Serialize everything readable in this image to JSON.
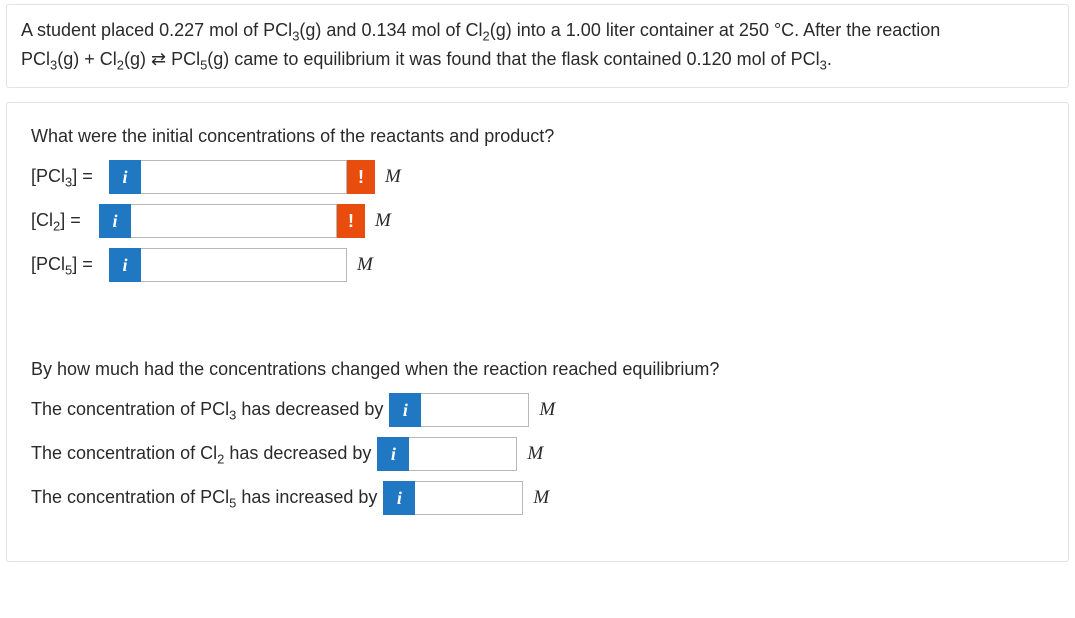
{
  "problem": {
    "line1_pre": "A student placed ",
    "mol_pcl3": "0.227",
    "line1_mid1": " mol of PCl",
    "sub3": "3",
    "line1_mid2": "(g) and ",
    "mol_cl2": "0.134",
    "line1_mid3": " mol of Cl",
    "sub2": "2",
    "line1_mid4": "(g) into a ",
    "volume": "1.00",
    "line1_mid5": " liter container at ",
    "temp": "250",
    "line1_post": " °C. After the reaction",
    "line2_pre": "PCl",
    "line2_a": "(g) + Cl",
    "line2_b": "(g) ",
    "arrows": "⇄",
    "line2_c": " PCl",
    "sub5": "5",
    "line2_d": "(g) came to equilibrium it was found that the flask contained ",
    "eq_mol": "0.120",
    "line2_e": " mol of PCl",
    "line2_end": "."
  },
  "q1": {
    "prompt": "What were the initial concentrations of the reactants and product?",
    "rows": [
      {
        "label_pre": "[PCl",
        "label_sub": "3",
        "label_post": "] = ",
        "error": true,
        "unit": "M",
        "value": ""
      },
      {
        "label_pre": "[Cl",
        "label_sub": "2",
        "label_post": "] = ",
        "error": true,
        "unit": "M",
        "value": ""
      },
      {
        "label_pre": "[PCl",
        "label_sub": "5",
        "label_post": "] = ",
        "error": false,
        "unit": "M",
        "value": ""
      }
    ]
  },
  "q2": {
    "prompt": "By how much had the concentrations changed when the reaction reached equilibrium?",
    "rows": [
      {
        "text_pre": "The concentration of PCl",
        "text_sub": "3",
        "text_post": " has decreased by",
        "unit": "M",
        "value": ""
      },
      {
        "text_pre": "The concentration of Cl",
        "text_sub": "2",
        "text_post": " has decreased by",
        "unit": "M",
        "value": ""
      },
      {
        "text_pre": "The concentration of PCl",
        "text_sub": "5",
        "text_post": " has increased by",
        "unit": "M",
        "value": ""
      }
    ]
  },
  "icons": {
    "info": "i",
    "err": "!"
  }
}
